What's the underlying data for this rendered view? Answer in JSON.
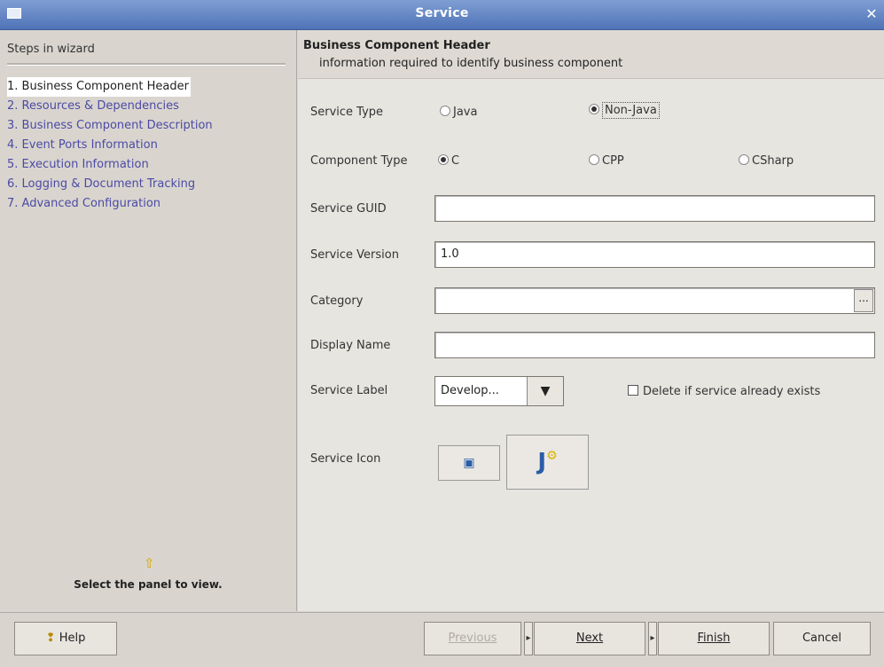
{
  "window": {
    "title": "Service"
  },
  "sidebar": {
    "header": "Steps in wizard",
    "steps": [
      "1. Business Component Header",
      "2. Resources & Dependencies",
      "3. Business Component Description",
      "4. Event Ports Information",
      "5. Execution Information",
      "6. Logging & Document Tracking",
      "7. Advanced Configuration"
    ],
    "hint": "Select the panel to view."
  },
  "panel": {
    "title": "Business Component Header",
    "subtitle": "information required to identify business component"
  },
  "form": {
    "service_type": {
      "label": "Service Type",
      "options": [
        "Java",
        "Non-Java"
      ],
      "selected": "Non-Java"
    },
    "component_type": {
      "label": "Component Type",
      "options": [
        "C",
        "CPP",
        "CSharp"
      ],
      "selected": "C"
    },
    "service_guid": {
      "label": "Service GUID",
      "value": ""
    },
    "service_version": {
      "label": "Service Version",
      "value": "1.0"
    },
    "category": {
      "label": "Category",
      "value": "",
      "browse": "..."
    },
    "display_name": {
      "label": "Display Name",
      "value": ""
    },
    "service_label": {
      "label": "Service Label",
      "value": "Develop..."
    },
    "delete_if_exists": {
      "label": "Delete if service already exists",
      "checked": false
    },
    "service_icon": {
      "label": "Service Icon"
    }
  },
  "buttons": {
    "help": "Help",
    "previous": "Previous",
    "next": "Next",
    "finish": "Finish",
    "cancel": "Cancel"
  }
}
